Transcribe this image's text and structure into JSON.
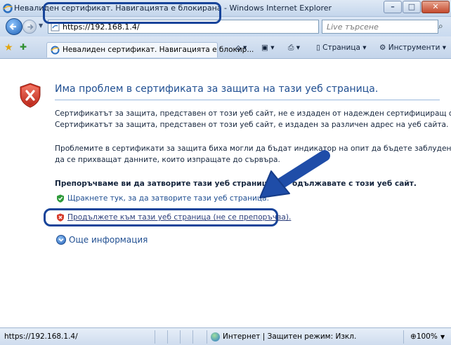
{
  "window": {
    "title": "Невалиден сертификат. Навигацията е блокирана - Windows Internet Explorer",
    "minimize_glyph": "–",
    "maximize_glyph": "□",
    "close_glyph": "✕"
  },
  "address_bar": {
    "url": "https://192.168.1.4/",
    "search_placeholder": "Live търсене"
  },
  "tab": {
    "label": "Невалиден сертификат. Навигацията е блокир..."
  },
  "commands": {
    "page": "Страница",
    "tools": "Инструменти"
  },
  "content": {
    "headline": "Има проблем в сертификата за защита на тази уеб страница.",
    "paragraph1": [
      "Сертификатът за защита, представен от този уеб сайт, не е издаден от надежден сертифициращ орган.",
      "Сертификатът за защита, представен от този уеб сайт, е издаден за различен адрес на уеб сайта."
    ],
    "paragraph2": [
      "Проблемите в сертификати за защита биха могли да бъдат индикатор на опит да бъдете заблудени или",
      "да се прихващат данните, които изпращате до сървъра."
    ],
    "recommendation": "Препоръчваме ви да затворите тази уеб страница и",
    "recommendation_tail": "одължавате с този уеб сайт.",
    "option_close": "Щракнете тук, за да затворите тази уеб страница.",
    "option_continue": "Продължете към тази уеб страница (не се препоръчва).",
    "more_info": "Още информация"
  },
  "status_bar": {
    "url": "https://192.168.1.4/",
    "zone": "Интернет | Защитен режим: Изкл.",
    "zoom": "100%"
  },
  "colors": {
    "highlight_border": "#17449a",
    "headline": "#1f4e91",
    "shield_red": "#d63a2a"
  }
}
